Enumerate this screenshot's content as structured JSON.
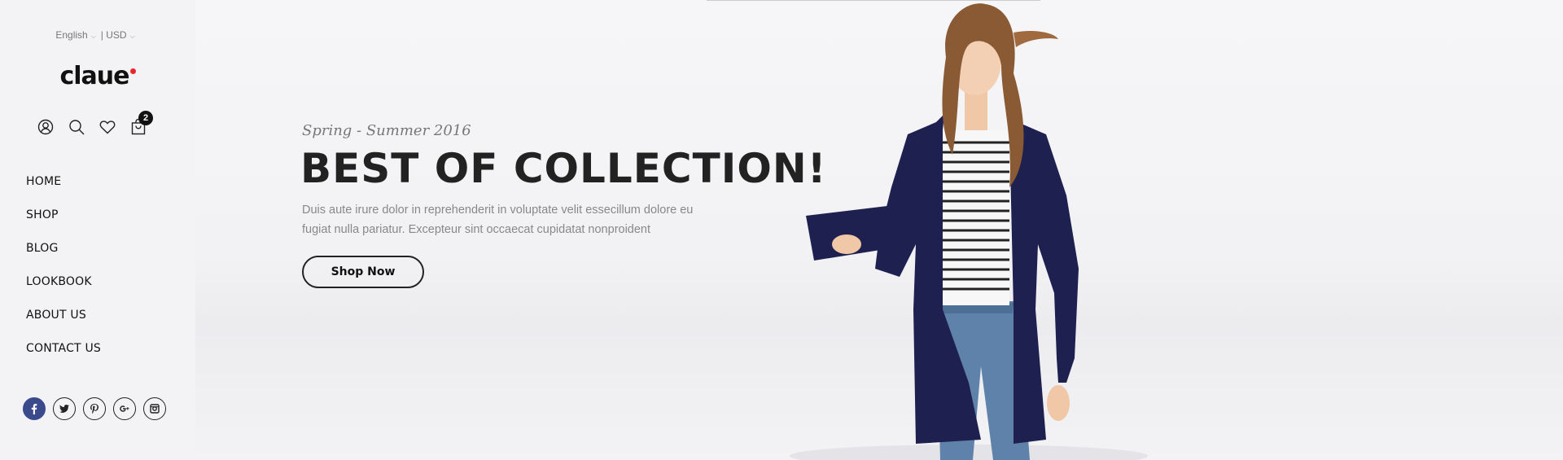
{
  "topbar": {
    "language": "English",
    "currency": "| USD"
  },
  "logo": {
    "text": "claue",
    "accent": "#e8262d"
  },
  "header_icons": [
    {
      "name": "user-icon"
    },
    {
      "name": "search-icon"
    },
    {
      "name": "heart-icon"
    },
    {
      "name": "cart-icon"
    }
  ],
  "cart": {
    "count": "2"
  },
  "nav": {
    "items": [
      {
        "label": "HOME"
      },
      {
        "label": "SHOP"
      },
      {
        "label": "BLOG"
      },
      {
        "label": "LOOKBOOK"
      },
      {
        "label": "ABOUT US"
      },
      {
        "label": "CONTACT US"
      }
    ]
  },
  "social": [
    {
      "name": "facebook-icon",
      "active": true,
      "color": "#3b4a8c"
    },
    {
      "name": "twitter-icon"
    },
    {
      "name": "pinterest-icon"
    },
    {
      "name": "google-plus-icon"
    },
    {
      "name": "instagram-icon"
    }
  ],
  "hero": {
    "subtitle": "Spring - Summer 2016",
    "headline": "BEST OF COLLECTION!",
    "description": "Duis aute irure dolor in reprehenderit in voluptate velit essecillum dolore eu fugiat nulla pariatur. Excepteur sint occaecat cupidatat nonproident",
    "button": "Shop Now"
  }
}
